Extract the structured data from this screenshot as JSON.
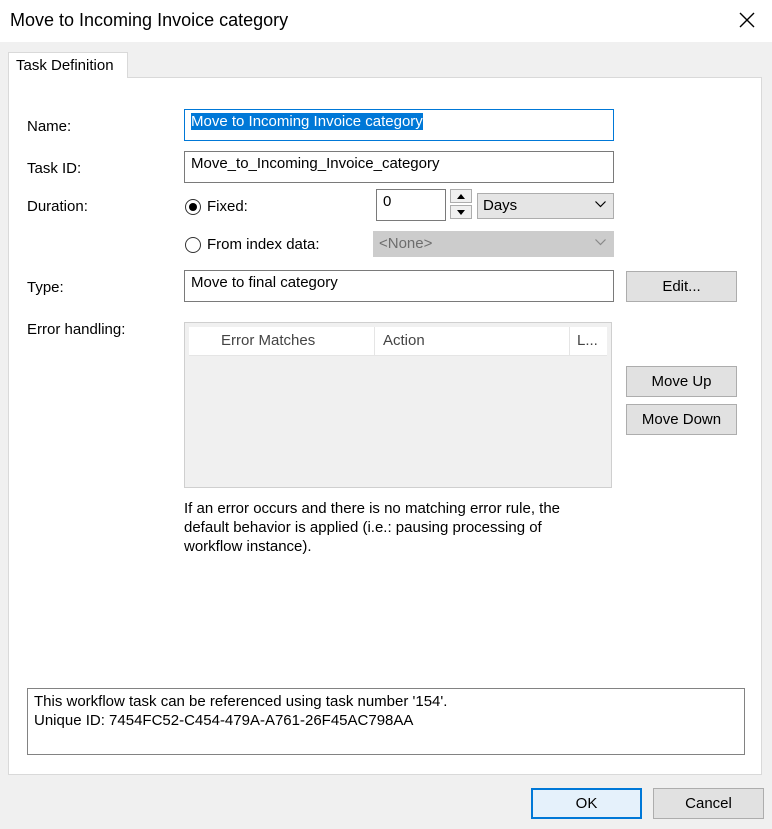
{
  "window": {
    "title": "Move to Incoming Invoice category"
  },
  "tabs": [
    {
      "label": "Task Definition"
    }
  ],
  "form": {
    "name_label": "Name:",
    "name_value": "Move to Incoming Invoice category",
    "task_id_label": "Task ID:",
    "task_id_value": "Move_to_Incoming_Invoice_category",
    "duration_label": "Duration:",
    "fixed_label": "Fixed:",
    "fixed_value": "0",
    "fixed_unit": "Days",
    "from_index_label": "From index data:",
    "from_index_value": "<None>",
    "type_label": "Type:",
    "type_value": "Move to final category",
    "edit_button": "Edit...",
    "error_handling_label": "Error handling:",
    "error_columns": [
      "Error Matches",
      "Action",
      "L..."
    ],
    "error_rows": [],
    "move_up_button": "Move Up",
    "move_down_button": "Move Down",
    "error_help_text": "If an error occurs and there is no matching error rule, the default behavior is applied (i.e.: pausing processing of workflow instance).",
    "info_line1": "This workflow task can be referenced using task number '154'.",
    "info_line2": "Unique ID: 7454FC52-C454-479A-A761-26F45AC798AA"
  },
  "footer": {
    "ok_button": "OK",
    "cancel_button": "Cancel"
  },
  "colors": {
    "accent": "#0078d7",
    "panel": "#ffffff",
    "window": "#f0f0f0"
  },
  "icons": [
    "close-icon",
    "spin-up-icon",
    "spin-down-icon",
    "chevron-down-icon"
  ]
}
